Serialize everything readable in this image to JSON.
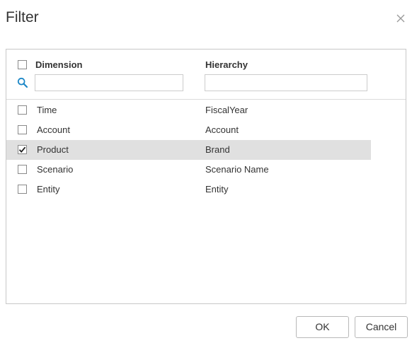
{
  "dialog": {
    "title": "Filter"
  },
  "columns": {
    "dimension": "Dimension",
    "hierarchy": "Hierarchy"
  },
  "search": {
    "dimension_value": "",
    "dimension_placeholder": "",
    "hierarchy_value": "",
    "hierarchy_placeholder": ""
  },
  "header_checkbox_checked": false,
  "rows": [
    {
      "dimension": "Time",
      "hierarchy": "FiscalYear",
      "checked": false,
      "selected": false
    },
    {
      "dimension": "Account",
      "hierarchy": "Account",
      "checked": false,
      "selected": false
    },
    {
      "dimension": "Product",
      "hierarchy": "Brand",
      "checked": true,
      "selected": true
    },
    {
      "dimension": "Scenario",
      "hierarchy": "Scenario Name",
      "checked": false,
      "selected": false
    },
    {
      "dimension": "Entity",
      "hierarchy": "Entity",
      "checked": false,
      "selected": false
    }
  ],
  "buttons": {
    "ok_label": "OK",
    "cancel_label": "Cancel"
  },
  "icons": {
    "close": "close-icon",
    "search": "search-icon",
    "check": "checkmark-icon"
  },
  "colors": {
    "selected_row": "#e0e0e0",
    "search_icon": "#1e88c7",
    "border": "#c8c8c8",
    "text": "#333333"
  }
}
